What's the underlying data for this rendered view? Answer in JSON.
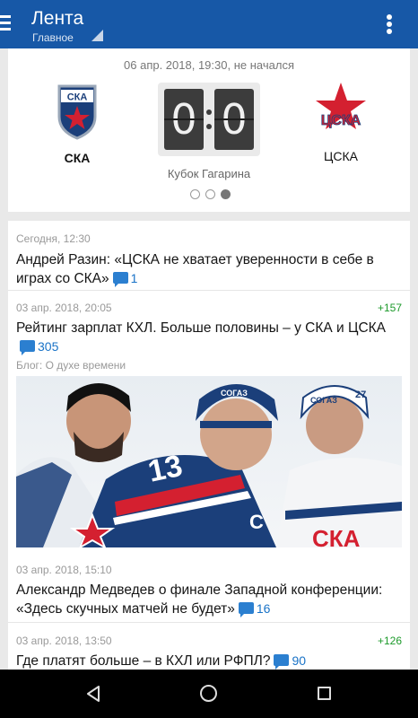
{
  "app_bar": {
    "title": "Лента",
    "subtitle": "Главное"
  },
  "match": {
    "date_status": "06 апр. 2018, 19:30, не начался",
    "home_team": "СКА",
    "away_team": "ЦСКА",
    "home_score": "0",
    "away_score": "0",
    "tournament": "Кубок Гагарина",
    "carousel_pages": 3,
    "carousel_active": 3,
    "home_logo_text": "СКА",
    "away_logo_text": "ЦСКА"
  },
  "news": [
    {
      "time": "Сегодня, 12:30",
      "title": "Андрей Разин: «ЦСКА не хватает уверенности в себе в играх со СКА»",
      "comments": "1",
      "rating": ""
    },
    {
      "time": "03 апр. 2018, 20:05",
      "title": "Рейтинг зарплат КХЛ. Больше половины – у СКА и ЦСКА",
      "comments": "305",
      "rating": "+157",
      "blog": "Блог: О духе времени",
      "image": "hockey-players-photo",
      "jersey_text": "СКА",
      "jersey_numbers": [
        "13",
        "27"
      ],
      "sponsor_text": "СОГАЗ"
    },
    {
      "time": "03 апр. 2018, 15:10",
      "title": "Александр Медведев о финале Западной конференции: «Здесь скучных матчей не будет»",
      "comments": "16",
      "rating": ""
    },
    {
      "time": "03 апр. 2018, 13:50",
      "title": "Где платят больше – в КХЛ или РФПЛ?",
      "comments": "90",
      "rating": "+126"
    }
  ],
  "icons": {
    "menu": "menu-icon",
    "overflow": "more-vert-icon",
    "comment": "comment-icon",
    "back": "back-icon",
    "home": "home-icon",
    "recents": "recents-icon"
  },
  "colors": {
    "app_bar": "#1758a7",
    "rating": "#1d9a2b",
    "comments": "#1a73c7",
    "navbar": "#000000"
  }
}
